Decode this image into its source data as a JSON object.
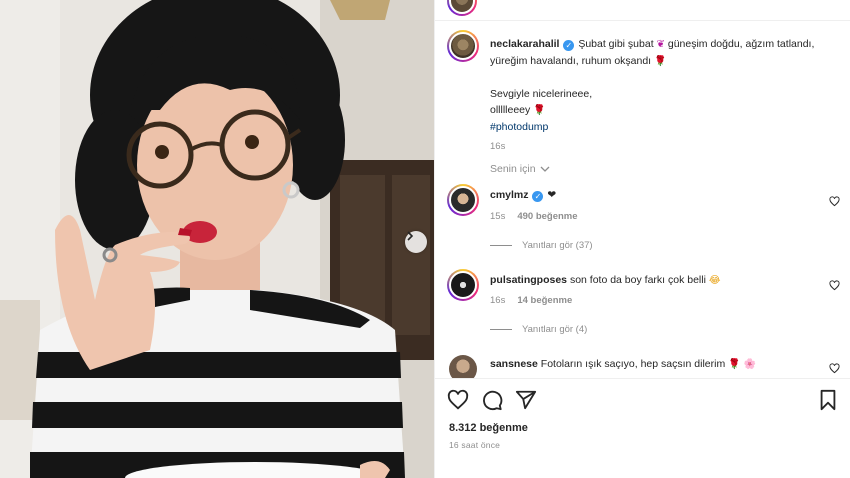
{
  "post": {
    "author": "neclakarahalil",
    "caption_line1": "Şubat gibi şubat",
    "caption_line1b": "güneşim doğdu, ağzım",
    "caption_line2": "tatlandı, yüreğim havalandı, ruhum okşandı",
    "caption_para2": "Sevgiyle nicelerineee,",
    "caption_para3": "ollllleeey",
    "hashtag": "#photodump",
    "caption_age": "16s",
    "likes": "8.312 beğenme",
    "posted": "16 saat önce"
  },
  "sort_label": "Senin için",
  "comments": [
    {
      "username": "cmylmz",
      "text": "❤",
      "age": "15s",
      "likes": "490 beğenme",
      "replies": "Yanıtları gör (37)"
    },
    {
      "username": "pulsatingposes",
      "text": "son foto da boy farkı çok belli",
      "age": "16s",
      "likes": "14 beğenme",
      "replies": "Yanıtları gör (4)"
    },
    {
      "username": "sansnese",
      "text": "Fotoların ışık saçıyo, hep saçsın dilerim"
    }
  ],
  "icons": {
    "like": "heart-icon",
    "comment": "comment-icon",
    "share": "share-icon",
    "save": "bookmark-icon",
    "next": "chevron-right-icon",
    "verified": "verified-badge-icon"
  },
  "colors": {
    "verified": "#3897f0",
    "hashtag": "#00376b",
    "muted": "#8e8e8e",
    "ring": "#ee2a7b"
  }
}
